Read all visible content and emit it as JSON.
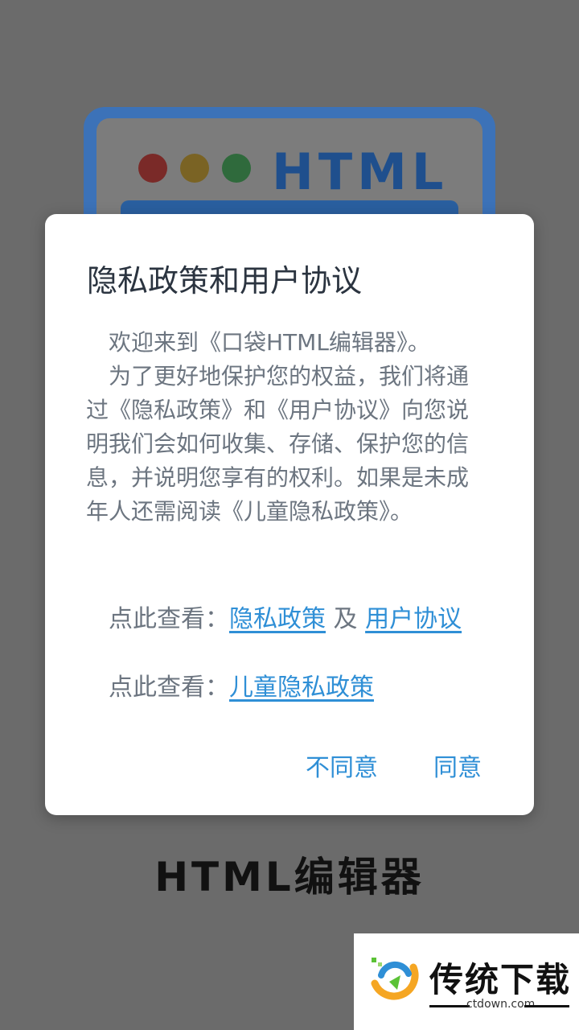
{
  "splash": {
    "icon_text": "HTML",
    "app_name": "HTML编辑器"
  },
  "dialog": {
    "title": "隐私政策和用户协议",
    "paragraphs": [
      "欢迎来到《口袋HTML编辑器》。",
      "为了更好地保护您的权益，我们将通过《隐私政策》和《用户协议》向您说明我们会如何收集、存储、保护您的信息，并说明您享有的权利。如果是未成年人还需阅读《儿童隐私政策》。"
    ],
    "view_label": "点此查看：",
    "privacy_link": "隐私政策",
    "conjunction": "及",
    "user_agreement_link": "用户协议",
    "children_privacy_link": "儿童隐私政策",
    "disagree_label": "不同意",
    "agree_label": "同意"
  },
  "watermark": {
    "name": "传统下载",
    "url": "ctdown.com"
  },
  "colors": {
    "accent": "#2f8fd6",
    "title": "#2b3440",
    "body_text": "#6c7580",
    "overlay": "#6b6b6b"
  }
}
